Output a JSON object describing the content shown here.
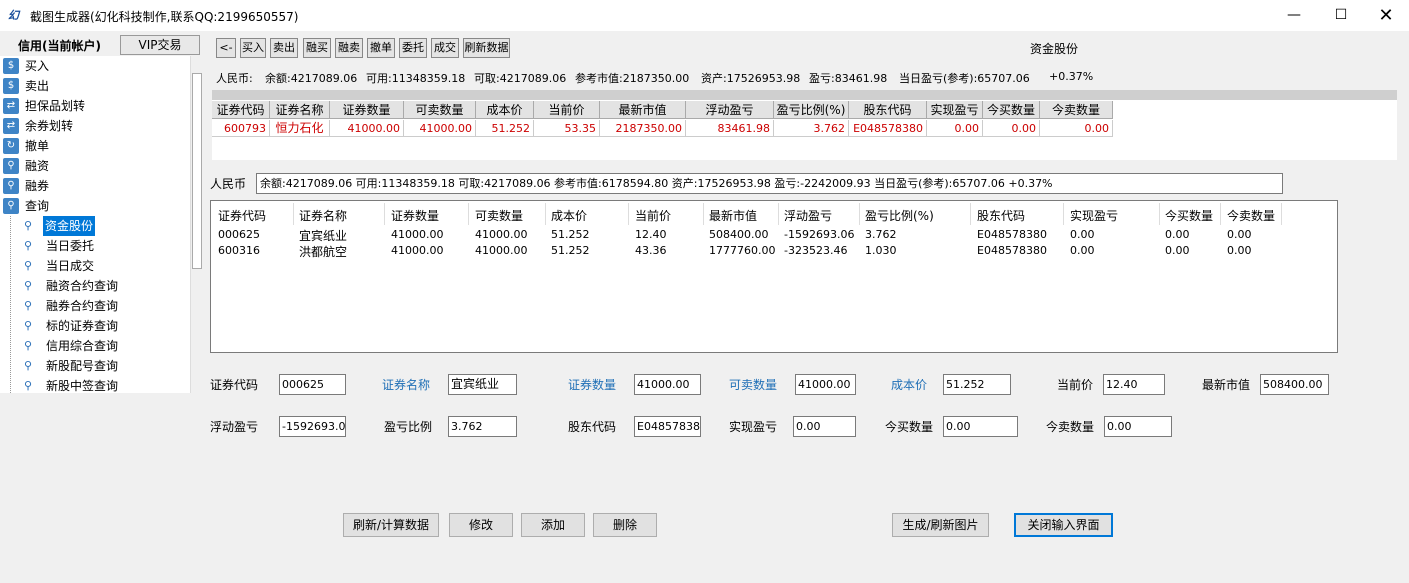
{
  "window": {
    "title": "截图生成器(幻化科技制作,联系QQ:2199650557)",
    "icon": "app-logo-icon",
    "controls": [
      "minimize-icon",
      "maximize-icon",
      "close-icon"
    ]
  },
  "sidebar": {
    "account_label": "信用(当前帐户)",
    "vip_button": "VIP交易",
    "items": [
      {
        "label": "买入",
        "icon": "buy-icon"
      },
      {
        "label": "卖出",
        "icon": "sell-icon"
      },
      {
        "label": "担保品划转",
        "icon": "transfer-icon"
      },
      {
        "label": "余券划转",
        "icon": "transfer-icon"
      },
      {
        "label": "撤单",
        "icon": "cancel-icon"
      },
      {
        "label": "融资",
        "icon": "search-icon"
      },
      {
        "label": "融券",
        "icon": "search-icon"
      },
      {
        "label": "查询",
        "icon": "search-icon"
      }
    ],
    "sub_items": [
      {
        "label": "资金股份",
        "selected": true
      },
      {
        "label": "当日委托"
      },
      {
        "label": "当日成交"
      },
      {
        "label": "融资合约查询"
      },
      {
        "label": "融券合约查询"
      },
      {
        "label": "标的证券查询"
      },
      {
        "label": "信用综合查询"
      },
      {
        "label": "新股配号查询"
      },
      {
        "label": "新股中签查询"
      }
    ]
  },
  "toolbar": {
    "buttons": [
      "<-",
      "买入",
      "卖出",
      "融买",
      "融卖",
      "撤单",
      "委托",
      "成交",
      "刷新数据"
    ],
    "title": "资金股份"
  },
  "summary": {
    "currency": "人民币:",
    "balance": "余额:4217089.06",
    "available": "可用:11348359.18",
    "withdrawable": "可取:4217089.06",
    "market_value": "参考市值:2187350.00",
    "assets": "资产:17526953.98",
    "profit": "盈亏:83461.98",
    "today_profit": "当日盈亏(参考):65707.06",
    "today_pct": "+0.37%"
  },
  "grid1": {
    "headers": [
      "证券代码",
      "证券名称",
      "证券数量",
      "可卖数量",
      "成本价",
      "当前价",
      "最新市值",
      "浮动盈亏",
      "盈亏比例(%)",
      "股东代码",
      "实现盈亏",
      "今买数量",
      "今卖数量"
    ],
    "rows": [
      [
        "600793",
        "恒力石化",
        "41000.00",
        "41000.00",
        "51.252",
        "53.35",
        "2187350.00",
        "83461.98",
        "3.762",
        "E048578380",
        "0.00",
        "0.00",
        "0.00"
      ]
    ]
  },
  "input_panel": {
    "currency_label": "人民币",
    "summary_text": "余额:4217089.06   可用:11348359.18   可取:4217089.06   参考市值:6178594.80   资产:17526953.98   盈亏:-2242009.93   当日盈亏(参考):65707.06   +0.37%",
    "grid2": {
      "headers": [
        "证券代码",
        "证券名称",
        "证券数量",
        "可卖数量",
        "成本价",
        "当前价",
        "最新市值",
        "浮动盈亏",
        "盈亏比例(%)",
        "股东代码",
        "实现盈亏",
        "今买数量",
        "今卖数量"
      ],
      "rows": [
        [
          "000625",
          "宜宾纸业",
          "41000.00",
          "41000.00",
          "51.252",
          "12.40",
          "508400.00",
          "-1592693.06",
          "3.762",
          "E048578380",
          "0.00",
          "0.00",
          "0.00"
        ],
        [
          "600316",
          "洪都航空",
          "41000.00",
          "41000.00",
          "51.252",
          "43.36",
          "1777760.00",
          "-323523.46",
          "1.030",
          "E048578380",
          "0.00",
          "0.00",
          "0.00"
        ]
      ]
    },
    "fields": {
      "code": {
        "label": "证券代码",
        "value": "000625"
      },
      "name": {
        "label": "证券名称",
        "value": "宜宾纸业"
      },
      "qty": {
        "label": "证券数量",
        "value": "41000.00"
      },
      "sellable": {
        "label": "可卖数量",
        "value": "41000.00"
      },
      "cost": {
        "label": "成本价",
        "value": "51.252"
      },
      "price": {
        "label": "当前价",
        "value": "12.40"
      },
      "mv": {
        "label": "最新市值",
        "value": "508400.00"
      },
      "float_pl": {
        "label": "浮动盈亏",
        "value": "-1592693.06"
      },
      "pl_ratio": {
        "label": "盈亏比例",
        "value": "3.762"
      },
      "holder": {
        "label": "股东代码",
        "value": "E048578380"
      },
      "realized": {
        "label": "实现盈亏",
        "value": "0.00"
      },
      "buy_today": {
        "label": "今买数量",
        "value": "0.00"
      },
      "sell_today": {
        "label": "今卖数量",
        "value": "0.00"
      }
    },
    "buttons": {
      "refresh": "刷新/计算数据",
      "edit": "修改",
      "add": "添加",
      "delete": "删除",
      "generate": "生成/刷新图片",
      "close": "关闭输入界面"
    }
  }
}
